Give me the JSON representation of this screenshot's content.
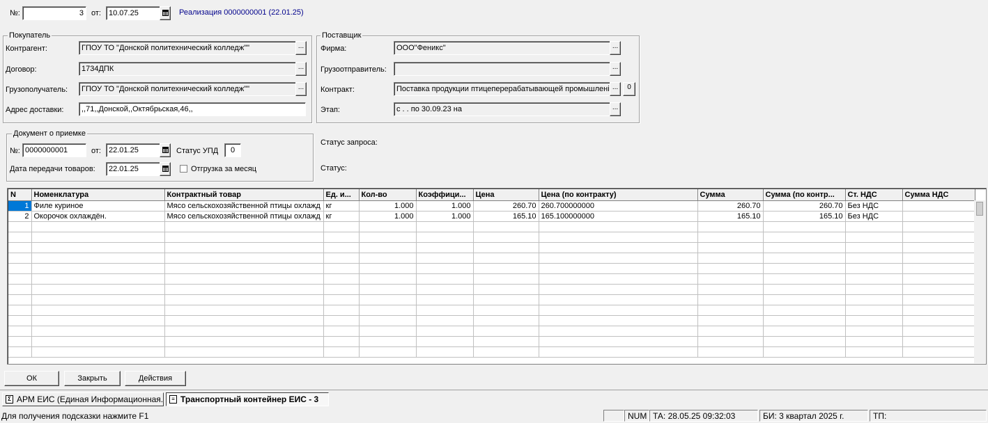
{
  "header": {
    "number_label": "№:",
    "number_value": "3",
    "date_label": "от:",
    "date_value": "10.07.25",
    "realization_link": "Реализация  0000000001 (22.01.25)"
  },
  "buyer": {
    "title": "Покупатель",
    "counterparty_label": "Контрагент:",
    "counterparty_value": "ГПОУ  ТО \"Донской политехнический колледж\"\"",
    "contract_label": "Договор:",
    "contract_value": "1734ДПК",
    "consignee_label": "Грузополучатель:",
    "consignee_value": "ГПОУ  ТО \"Донской политехнический колледж\"\"",
    "address_label": "Адрес доставки:",
    "address_value": ",,71,,Донской,,Октябрьская,46,,"
  },
  "supplier": {
    "title": "Поставщик",
    "firm_label": "Фирма:",
    "firm_value": "ООО\"Феникс\"",
    "shipper_label": "Грузоотправитель:",
    "shipper_value": "",
    "contract_label": "Контракт:",
    "contract_value": "Поставка продукции птицеперерабатывающей промышлені",
    "contract_extra_btn": "0",
    "stage_label": "Этап:",
    "stage_value": "с   .   .    по 30.09.23 на"
  },
  "acceptance": {
    "title": "Документ о приемке",
    "number_label": "№:",
    "number_value": "0000000001",
    "date_label": "от:",
    "date_value": "22.01.25",
    "upd_status_label": "Статус УПД",
    "upd_status_value": "0",
    "transfer_date_label": "Дата передачи товаров:",
    "transfer_date_value": "22.01.25",
    "monthly_label": "Отгрузка за месяц"
  },
  "status": {
    "request_status_label": "Статус запроса:",
    "status_label": "Статус:"
  },
  "table": {
    "columns": [
      "N",
      "Номенклатура",
      "Контрактный товар",
      "Ед. и...",
      "Кол-во",
      "Коэффици...",
      "Цена",
      "Цена (по контракту)",
      "Сумма",
      "Сумма (по контр...",
      "Ст. НДС",
      "Сумма НДС"
    ],
    "rows": [
      [
        "1",
        "Филе куриное",
        "Мясо сельскохозяйственной птицы охлажд",
        "кг",
        "1.000",
        "1.000",
        "260.70",
        "260.700000000",
        "260.70",
        "260.70",
        "Без НДС",
        ""
      ],
      [
        "2",
        "Окорочок  охлаждён.",
        "Мясо сельскохозяйственной птицы охлажд",
        "кг",
        "1.000",
        "1.000",
        "165.10",
        "165.100000000",
        "165.10",
        "165.10",
        "Без НДС",
        ""
      ]
    ]
  },
  "buttons": {
    "ok": "ОК",
    "close": "Закрыть",
    "actions": "Действия",
    "dots": "...",
    "calendar": "calendar-icon"
  },
  "taskbar": {
    "task1": "АРМ ЕИС (Единая Информационная...",
    "task2": "Транспортный контейнер ЕИС - 3"
  },
  "statusbar": {
    "hint": "Для получения подсказки нажмите F1",
    "num": "NUM",
    "ta": "ТА: 28.05.25  09:32:03",
    "bi": "БИ: 3 квартал 2025 г.",
    "tp": "ТП:"
  }
}
